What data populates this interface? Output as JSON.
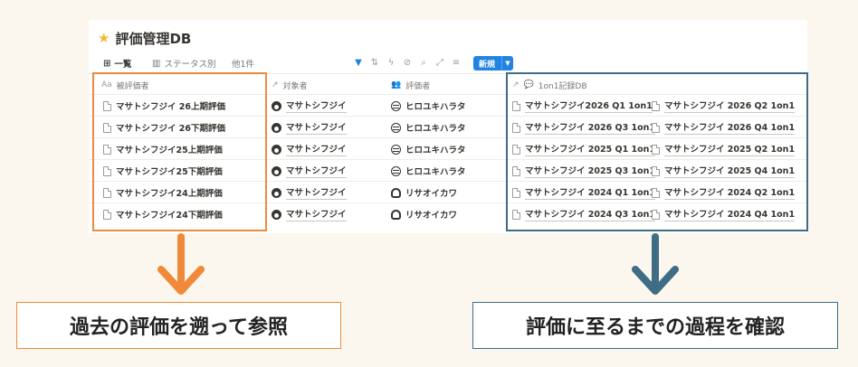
{
  "database": {
    "title": "評価管理DB",
    "icon": "star-icon"
  },
  "toolbar": {
    "tabs": [
      {
        "label": "一覧",
        "icon": "table-icon",
        "active": true
      },
      {
        "label": "ステータス別",
        "icon": "board-icon",
        "active": false
      },
      {
        "label": "他1件",
        "active": false
      }
    ],
    "tool_icons": [
      "filter-icon",
      "sort-icon",
      "automation-icon",
      "hide-icon",
      "search-icon",
      "expand-icon",
      "settings-icon"
    ],
    "new_label": "新規"
  },
  "table": {
    "headers": [
      {
        "label": "被評価者",
        "icon": "Aa"
      },
      {
        "label": "対象者",
        "icon": "↗"
      },
      {
        "label": "評価者",
        "icon": "people-icon"
      },
      {
        "label": "1on1記録DB",
        "icon": "↗"
      }
    ],
    "rows": [
      {
        "name": "マサトシフジイ 26上期評価",
        "target": "マサトシフジイ",
        "evaluator": "ヒロユキハラタ",
        "evaluator_avatar": "hir",
        "records": [
          "マサトシフジイ2026 Q1 1on1",
          "マサトシフジイ 2026 Q2 1on1"
        ]
      },
      {
        "name": "マサトシフジイ 26下期評価",
        "target": "マサトシフジイ",
        "evaluator": "ヒロユキハラタ",
        "evaluator_avatar": "hir",
        "records": [
          "マサトシフジイ 2026 Q3 1on1",
          "マサトシフジイ 2026 Q4 1on1"
        ]
      },
      {
        "name": "マサトシフジイ25上期評価",
        "target": "マサトシフジイ",
        "evaluator": "ヒロユキハラタ",
        "evaluator_avatar": "hir",
        "records": [
          "マサトシフジイ 2025 Q1 1on1",
          "マサトシフジイ 2025 Q2 1on1"
        ]
      },
      {
        "name": "マサトシフジイ25下期評価",
        "target": "マサトシフジイ",
        "evaluator": "ヒロユキハラタ",
        "evaluator_avatar": "hir",
        "records": [
          "マサトシフジイ 2025 Q3 1on1",
          "マサトシフジイ 2025 Q4 1on1"
        ]
      },
      {
        "name": "マサトシフジイ24上期評価",
        "target": "マサトシフジイ",
        "evaluator": "リサオイカワ",
        "evaluator_avatar": "ris",
        "records": [
          "マサトシフジイ 2024 Q1 1on1",
          "マサトシフジイ 2024 Q2 1on1"
        ]
      },
      {
        "name": "マサトシフジイ24下期評価",
        "target": "マサトシフジイ",
        "evaluator": "リサオイカワ",
        "evaluator_avatar": "ris",
        "records": [
          "マサトシフジイ 2024 Q3 1on1",
          "マサトシフジイ 2024 Q4 1on1"
        ]
      }
    ]
  },
  "annotations": {
    "left_caption": "過去の評価を遡って参照",
    "right_caption": "評価に至るまでの過程を確認",
    "left_color": "#f08a3a",
    "right_color": "#3f6d84"
  }
}
